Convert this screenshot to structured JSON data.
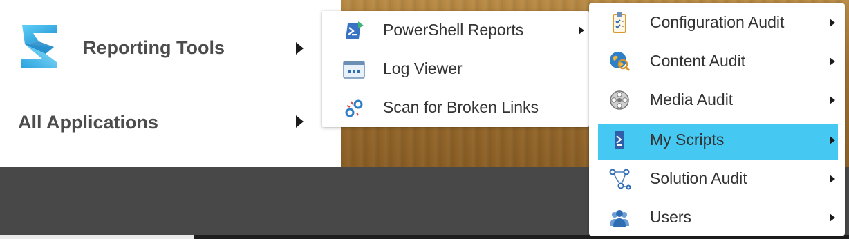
{
  "main_menu": {
    "items": [
      {
        "label": "Reporting Tools",
        "icon": "reporting-tools-logo-icon",
        "has_submenu": true
      },
      {
        "label": "All Applications",
        "has_submenu": true
      }
    ]
  },
  "reporting_submenu": {
    "items": [
      {
        "label": "PowerShell Reports",
        "icon": "powershell-reports-icon",
        "has_submenu": true
      },
      {
        "label": "Log Viewer",
        "icon": "log-viewer-icon",
        "has_submenu": false
      },
      {
        "label": "Scan for Broken Links",
        "icon": "broken-links-icon",
        "has_submenu": false
      }
    ]
  },
  "powershell_submenu": {
    "active_item": "My Scripts",
    "items": [
      {
        "label": "Configuration Audit",
        "icon": "clipboard-checklist-icon",
        "has_submenu": true
      },
      {
        "label": "Content Audit",
        "icon": "globe-magnifier-icon",
        "has_submenu": true
      },
      {
        "label": "Media Audit",
        "icon": "film-reel-icon",
        "has_submenu": true
      },
      {
        "label": "My Scripts",
        "icon": "powershell-script-icon",
        "has_submenu": true
      },
      {
        "label": "Solution Audit",
        "icon": "network-nodes-icon",
        "has_submenu": true
      },
      {
        "label": "Users",
        "icon": "users-group-icon",
        "has_submenu": true
      }
    ]
  },
  "colors": {
    "highlight": "#45c9f3",
    "menu_bg": "#ffffff",
    "text": "#333333",
    "taskbar": "#484848"
  }
}
